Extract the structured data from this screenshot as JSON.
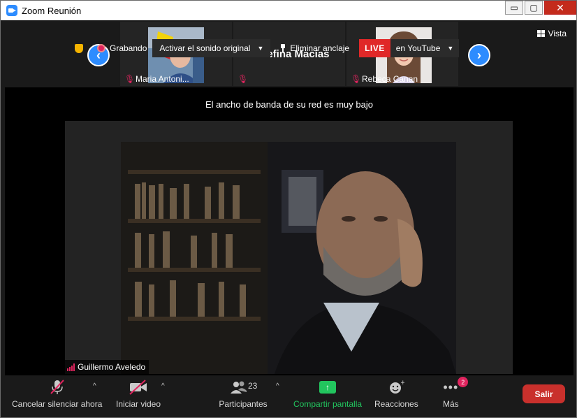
{
  "window": {
    "title": "Zoom Reunión",
    "minimize": "▭",
    "maximize": "▢",
    "close": "✕"
  },
  "gallery": {
    "prev_icon": "chevron-left-icon",
    "next_icon": "chevron-right-icon",
    "participants": [
      {
        "name": "Maria Antoni...",
        "muted": true
      },
      {
        "name": "Josefina Macías",
        "muted": true
      },
      {
        "name": "Rebeca Canan",
        "muted": true
      }
    ],
    "view_label": "Vista"
  },
  "main": {
    "bandwidth_notice": "El ancho de banda de su red es muy bajo",
    "recording_label": "Grabando",
    "original_sound_label": "Activar el sonido original",
    "unpin_label": "Eliminar anclaje",
    "live_badge": "LIVE",
    "live_destination": "en YouTube",
    "active_speaker": "Guillermo Aveledo"
  },
  "toolbar": {
    "unmute_label": "Cancelar silenciar ahora",
    "start_video_label": "Iniciar video",
    "participants_label": "Participantes",
    "participants_count": "23",
    "share_label": "Compartir pantalla",
    "reactions_label": "Reacciones",
    "more_label": "Más",
    "more_badge": "2",
    "leave_label": "Salir"
  },
  "colors": {
    "accent": "#2d8cff",
    "danger": "#e0245e",
    "share": "#22c55e",
    "leave": "#c9302c",
    "live": "#e02828"
  }
}
